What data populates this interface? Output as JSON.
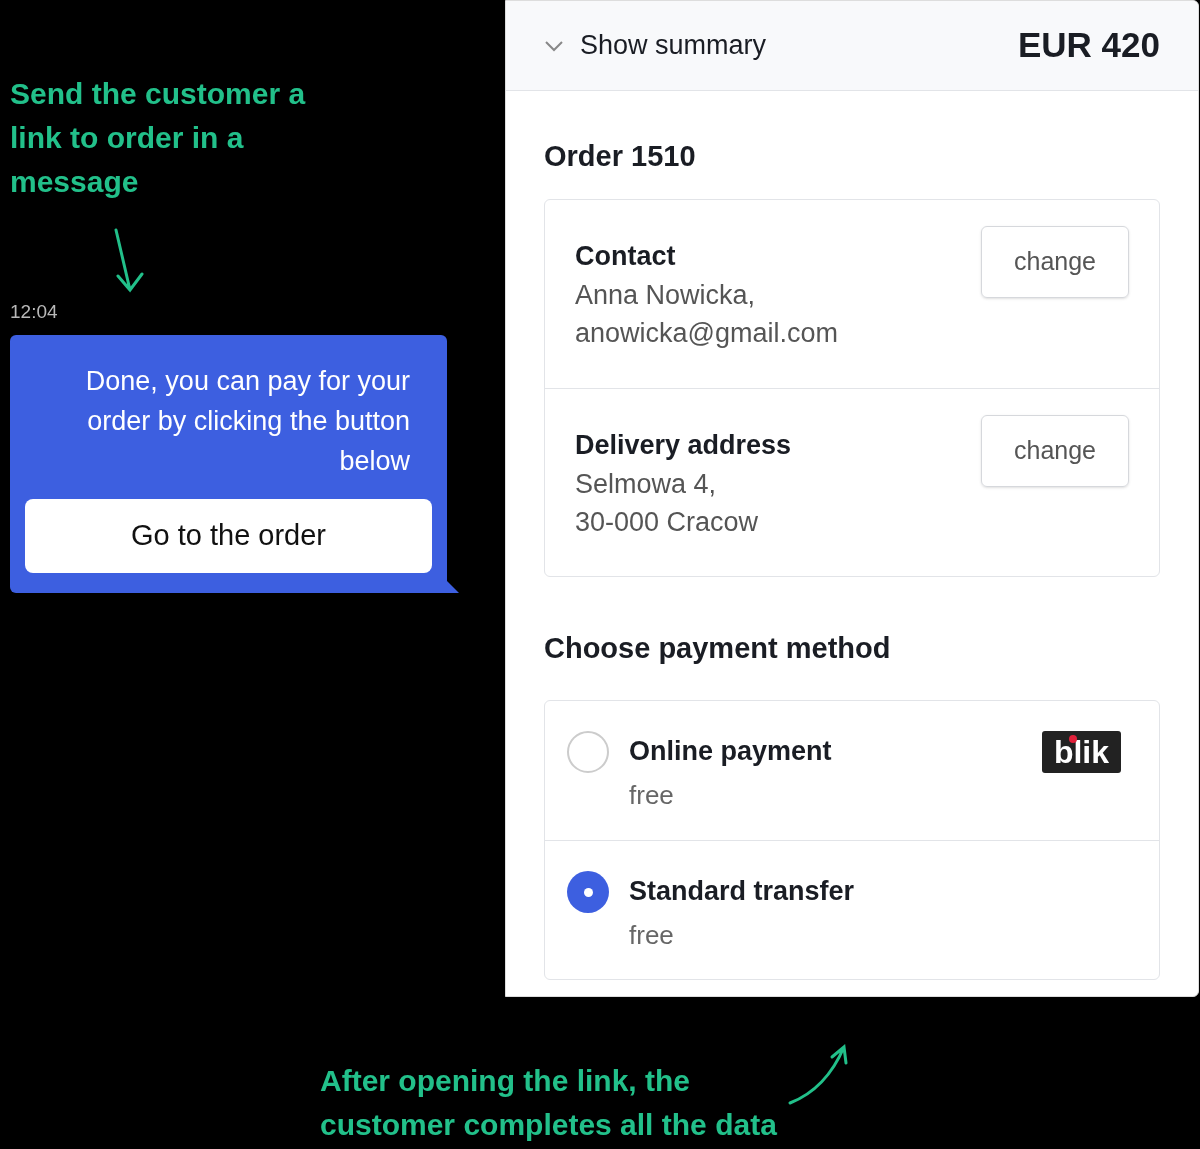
{
  "annotations": [
    {
      "text": "Send the customer a link to order in a message"
    },
    {
      "text": "After opening the link, the customer completes all the data"
    }
  ],
  "chat": {
    "time": "12:04",
    "message": "Done, you can pay for your order by clicking the button below",
    "button": "Go to the order"
  },
  "checkout": {
    "summary_toggle": "Show summary",
    "total": "EUR 420",
    "order_title": "Order 1510",
    "details": [
      {
        "title": "Contact",
        "lines": [
          "Anna Nowicka,",
          "anowicka@gmail.com"
        ],
        "action": "change"
      },
      {
        "title": "Delivery address",
        "lines": [
          "Selmowa 4,",
          "30-000 Cracow"
        ],
        "action": "change"
      }
    ],
    "payment_heading": "Choose payment method",
    "payment_methods": [
      {
        "name": "Online payment",
        "fee": "free",
        "selected": false,
        "logo": "blik"
      },
      {
        "name": "Standard transfer",
        "fee": "free",
        "selected": true
      }
    ]
  }
}
